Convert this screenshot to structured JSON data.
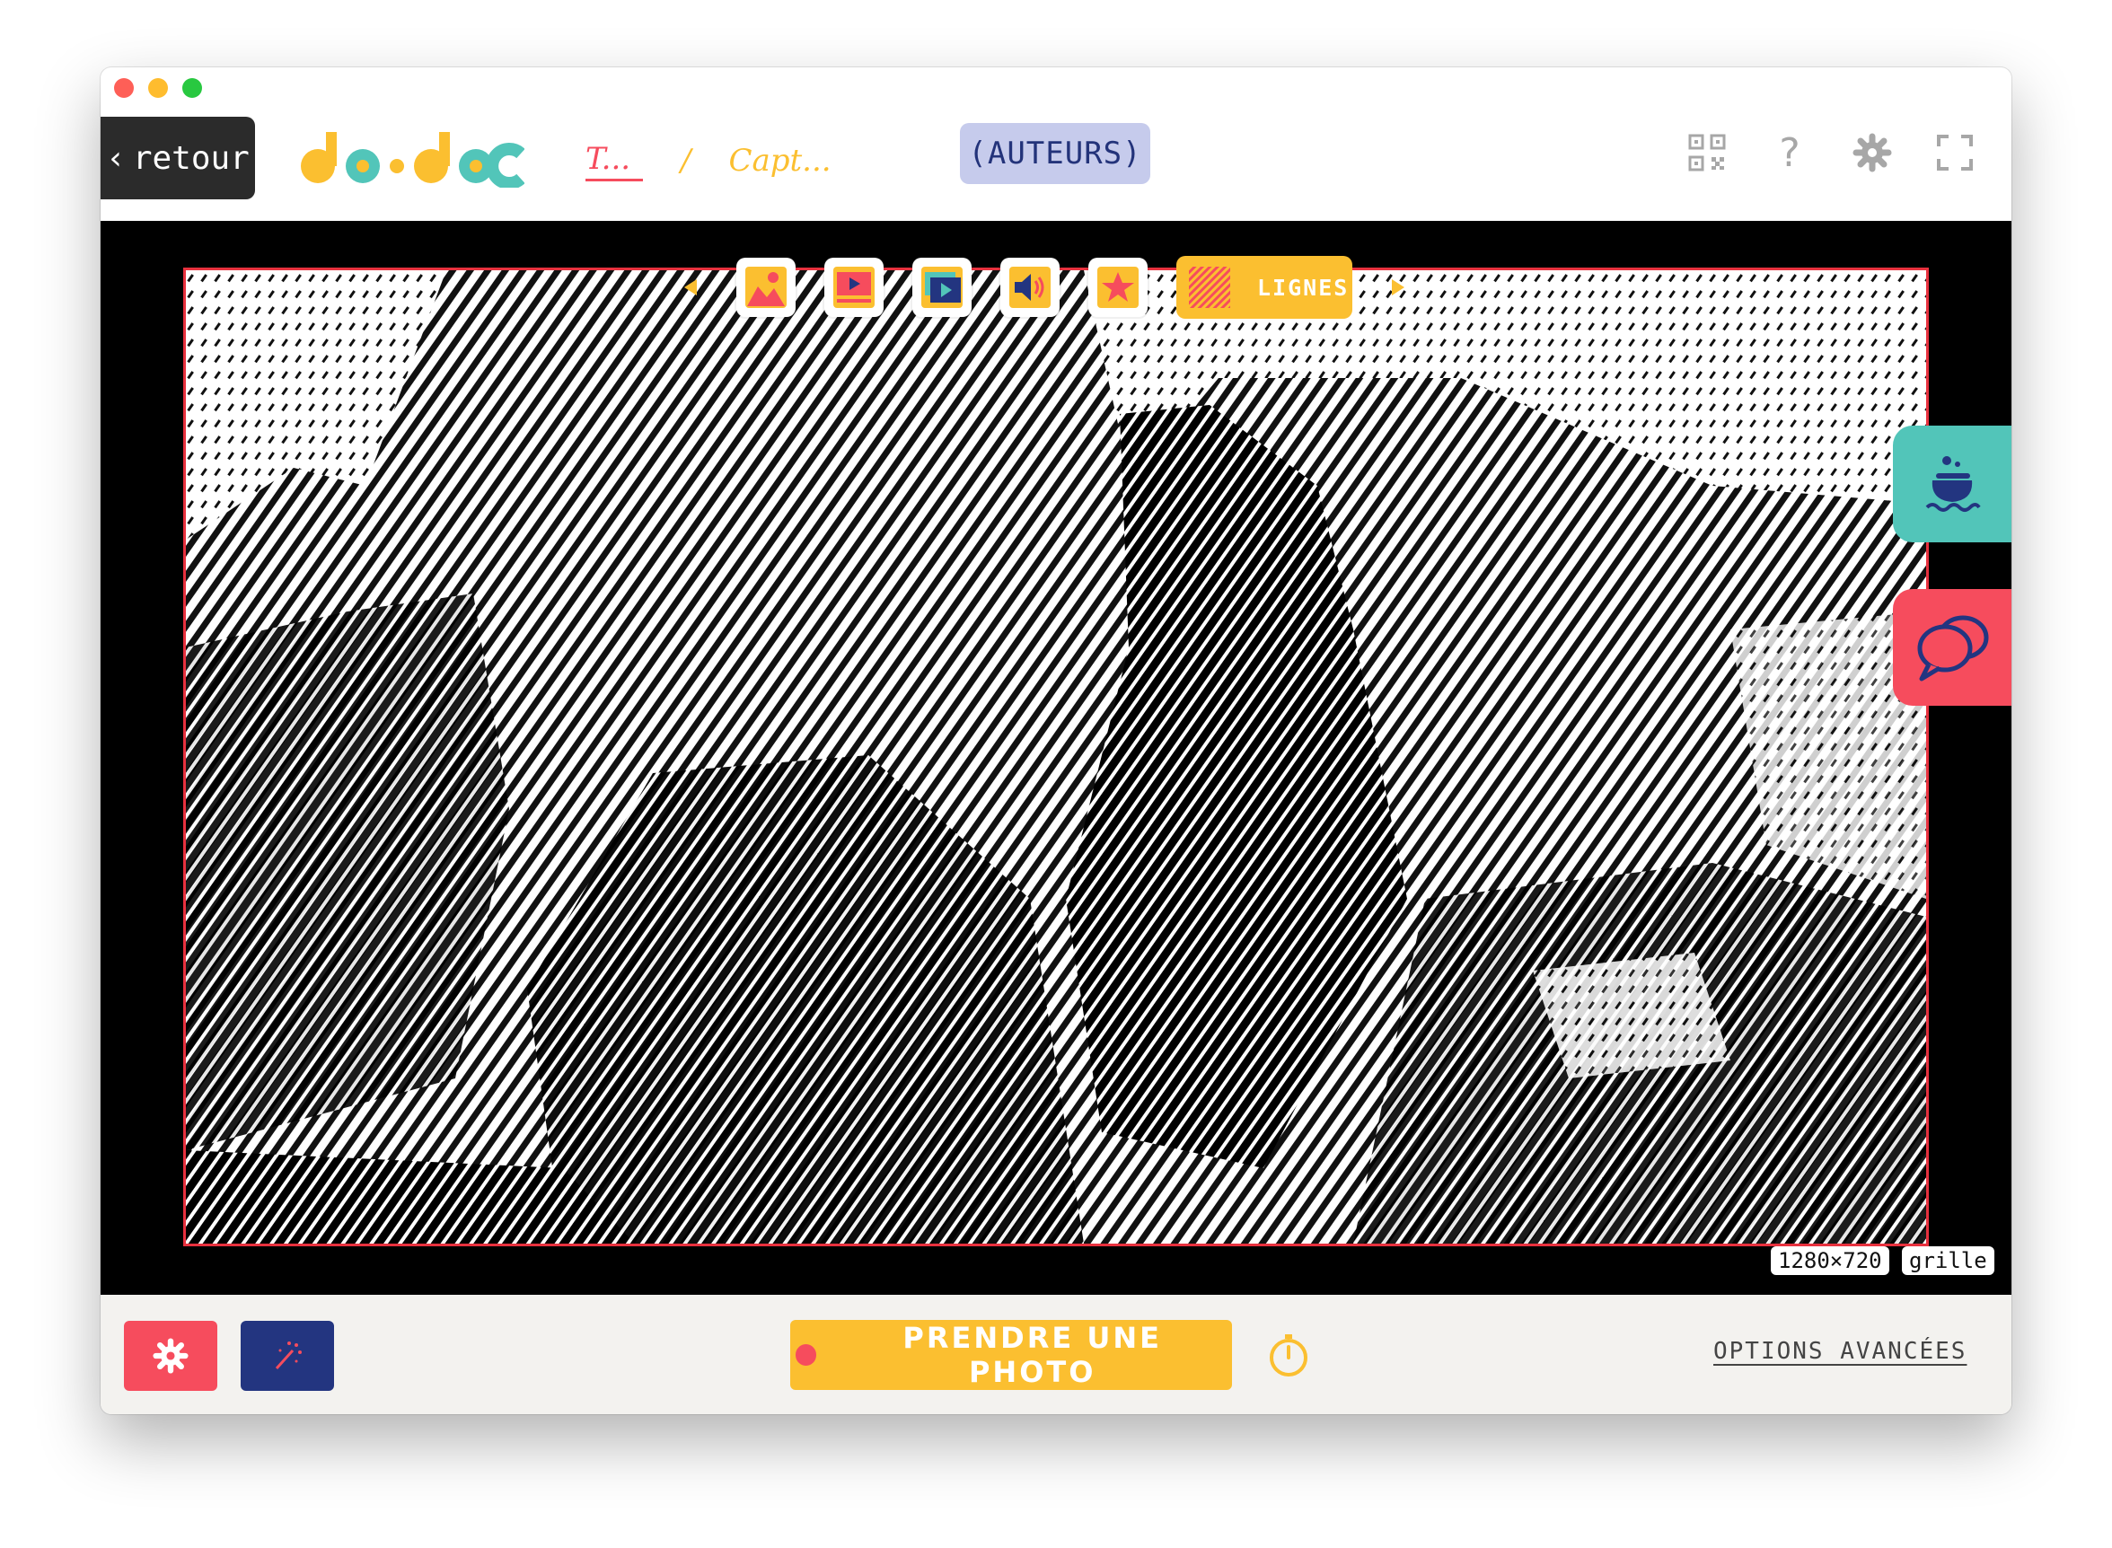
{
  "window": {
    "traffic_lights": [
      "close",
      "minimize",
      "zoom"
    ]
  },
  "topbar": {
    "back_label": "retour",
    "back_icon": "chevron-left-icon",
    "logo_text": "do•doc",
    "breadcrumb": [
      "T...",
      "/",
      "Capt..."
    ],
    "authors_label": "(AUTEURS)",
    "icons": [
      "qr-code-icon",
      "help-icon",
      "gear-icon",
      "fullscreen-icon"
    ]
  },
  "capture": {
    "modes": [
      "photo-mode-icon",
      "video-mode-icon",
      "stopmotion-mode-icon",
      "audio-mode-icon",
      "effects-mode-icon"
    ],
    "active_effect_label": "LIGNES",
    "resolution": "1280×720",
    "grid_label": "grille",
    "side_tabs": [
      "cauldron-icon",
      "chat-bubbles-icon"
    ]
  },
  "bottombar": {
    "settings_icon": "gear-icon",
    "effects_icon": "magic-wand-icon",
    "photo_label": "PRENDRE UNE PHOTO",
    "timer_icon": "stopwatch-icon",
    "advanced_label": "OPTIONS AVANCÉES"
  },
  "colors": {
    "accent_yellow": "#fbbf30",
    "accent_red": "#f64c5d",
    "accent_teal": "#52c5b9",
    "accent_navy": "#233580",
    "authors_bg": "#c6cbec"
  }
}
